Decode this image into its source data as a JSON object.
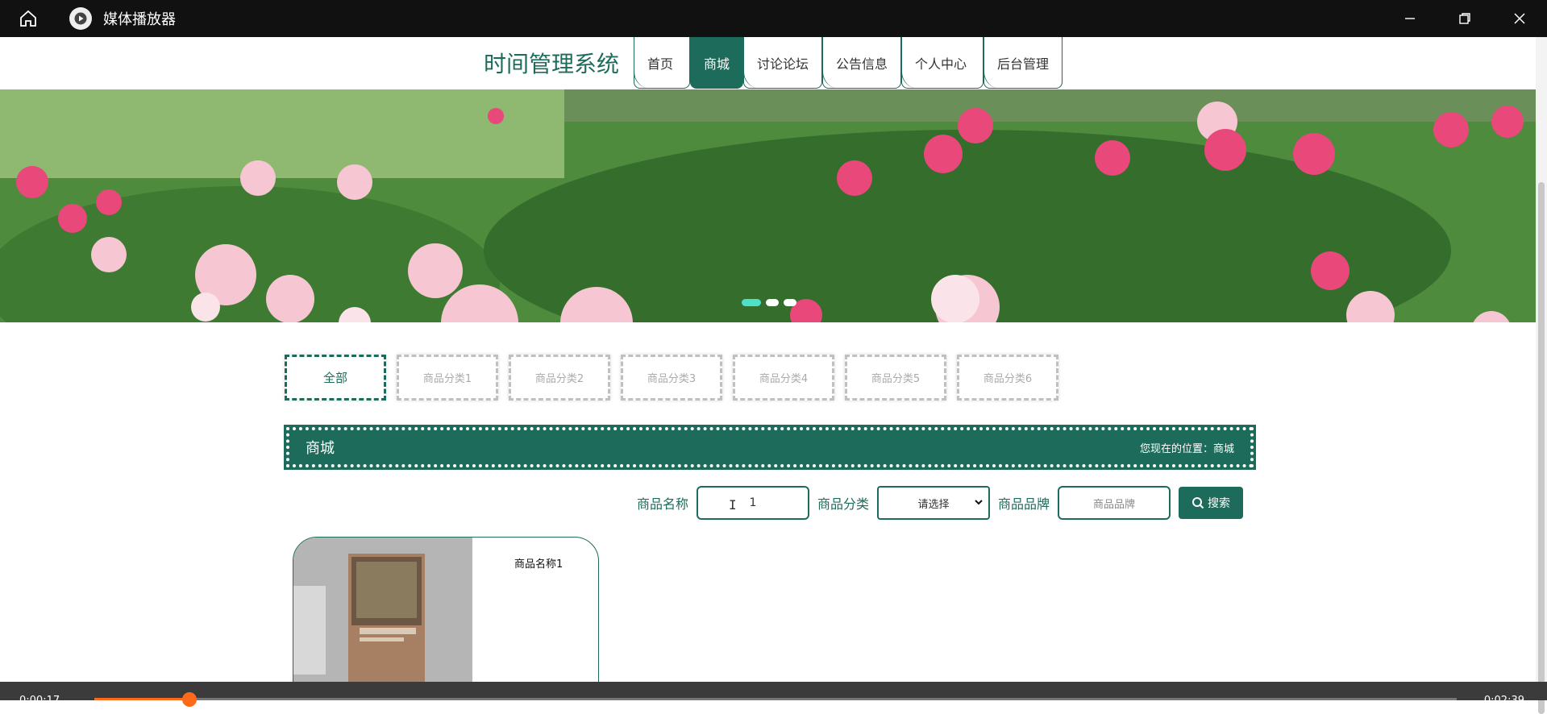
{
  "player": {
    "app_title": "媒体播放器",
    "time_elapsed": "0:00:17",
    "time_total": "0:02:39",
    "progress": 0.07,
    "accent_color": "#ff6a1a"
  },
  "site": {
    "title": "时间管理系统",
    "brand_color": "#1d6b5a",
    "nav": [
      "首页",
      "商城",
      "讨论论坛",
      "公告信息",
      "个人中心",
      "后台管理"
    ],
    "nav_active": "商城"
  },
  "banner": {
    "slides": 3,
    "active_slide": 1
  },
  "categories": [
    "全部",
    "商品分类1",
    "商品分类2",
    "商品分类3",
    "商品分类4",
    "商品分类5",
    "商品分类6"
  ],
  "section": {
    "title": "商城",
    "breadcrumb": "您现在的位置：商城"
  },
  "search": {
    "name_label": "商品名称",
    "name_value": "1",
    "category_label": "商品分类",
    "category_value": "请选择",
    "brand_label": "商品品牌",
    "brand_placeholder": "商品品牌",
    "button_label": "搜索"
  },
  "products": [
    {
      "name": "商品名称1"
    }
  ]
}
